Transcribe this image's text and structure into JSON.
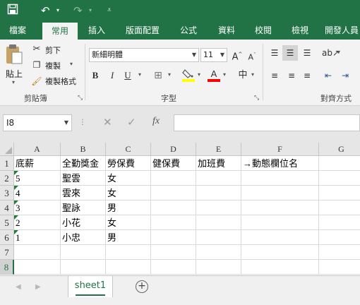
{
  "quick_access": {
    "save_icon": "save-icon",
    "undo_icon": "undo-icon",
    "redo_icon": "redo-icon",
    "customize_icon": "customize-icon"
  },
  "ribbon_tabs": [
    "檔案",
    "常用",
    "插入",
    "版面配置",
    "公式",
    "資料",
    "校閱",
    "檢視",
    "開發人員"
  ],
  "active_tab": "常用",
  "clipboard": {
    "paste": "貼上",
    "cut": "剪下",
    "copy": "複製",
    "format_painter": "複製格式",
    "group_label": "剪貼簿"
  },
  "font": {
    "name": "新細明體",
    "size": "11",
    "bold": "B",
    "italic": "I",
    "underline": "U",
    "group_label": "字型",
    "font_color": "#ff0000",
    "highlight_color": "#ffff00"
  },
  "alignment": {
    "group_label": "對齊方式"
  },
  "formula_bar": {
    "name_box": "I8",
    "cancel": "✕",
    "enter": "✓",
    "function": "fx",
    "formula": ""
  },
  "columns": [
    "A",
    "B",
    "C",
    "D",
    "E",
    "F",
    "G"
  ],
  "rows": [
    [
      "底薪",
      "全勤獎金",
      "勞保費",
      "健保費",
      "加班費",
      "→動態欄位名",
      ""
    ],
    [
      "5",
      "聖雲",
      "女",
      "",
      "",
      "",
      ""
    ],
    [
      "4",
      "雲來",
      "女",
      "",
      "",
      "",
      ""
    ],
    [
      "3",
      "聖詠",
      "男",
      "",
      "",
      "",
      ""
    ],
    [
      "2",
      "小花",
      "女",
      "",
      "",
      "",
      ""
    ],
    [
      "1",
      "小忠",
      "男",
      "",
      "",
      "",
      ""
    ],
    [
      "",
      "",
      "",
      "",
      "",
      "",
      ""
    ],
    [
      "",
      "",
      "",
      "",
      "",
      "",
      ""
    ]
  ],
  "row_numbers": [
    "1",
    "2",
    "3",
    "4",
    "5",
    "6",
    "7",
    "8"
  ],
  "sheets": [
    "sheet1"
  ],
  "colors": {
    "accent": "#217346"
  }
}
